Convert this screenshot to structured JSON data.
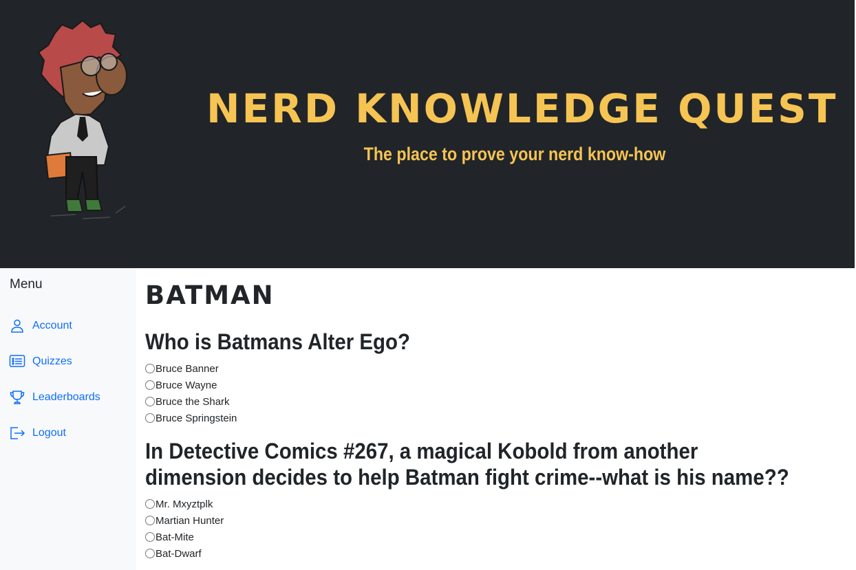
{
  "header": {
    "title": "NERD KNOWLEDGE QUEST",
    "subtitle": "The place to prove your nerd know-how",
    "mascot_icon": "cartoon-nerd-mascot"
  },
  "sidebar": {
    "title": "Menu",
    "items": [
      {
        "label": "Account",
        "icon": "person-icon"
      },
      {
        "label": "Quizzes",
        "icon": "list-icon"
      },
      {
        "label": "Leaderboards",
        "icon": "trophy-icon"
      },
      {
        "label": "Logout",
        "icon": "logout-icon"
      }
    ]
  },
  "quiz": {
    "title": "BATMAN",
    "questions": [
      {
        "text": "Who is Batmans Alter Ego?",
        "options": [
          "Bruce Banner",
          "Bruce Wayne",
          "Bruce the Shark",
          "Bruce Springstein"
        ]
      },
      {
        "text": "In Detective Comics #267, a magical Kobold from another dimension decides to help Batman fight crime--what is his name??",
        "options": [
          "Mr. Mxyztplk",
          "Martian Hunter",
          "Bat-Mite",
          "Bat-Dwarf"
        ]
      }
    ]
  },
  "colors": {
    "header_bg": "#212529",
    "accent": "#f6c453",
    "link": "#0d6efd",
    "sidebar_bg": "#f8f9fa"
  }
}
